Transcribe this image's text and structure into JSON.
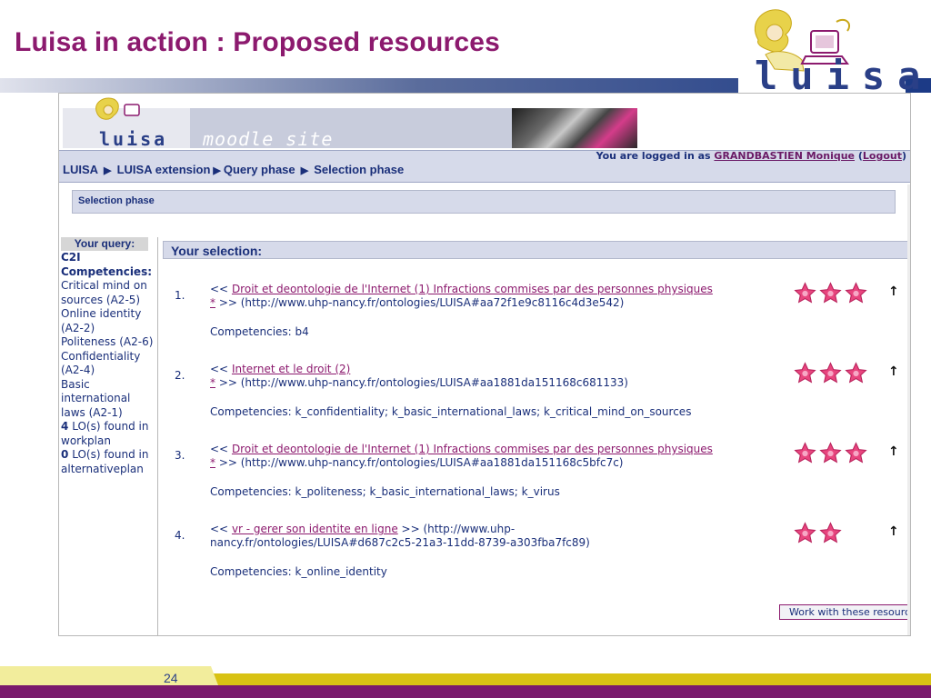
{
  "slide": {
    "title": "Luisa in action : Proposed resources",
    "logo_text": "luisa",
    "page_number": "24"
  },
  "moodle": {
    "banner_logo": "luisa",
    "banner_site": "moodle site",
    "breadcrumb": [
      "LUISA",
      "LUISA extension",
      "Query phase",
      "Selection phase"
    ],
    "login": {
      "prefix": "You are logged in as ",
      "user": "GRANDBASTIEN Monique",
      "logout": "Logout"
    },
    "phase_title": "Selection phase"
  },
  "query": {
    "header": "Your query:",
    "lines": [
      {
        "text": "C2I",
        "bold": true
      },
      {
        "text": "Competencies:",
        "bold": true
      },
      {
        "text": "Critical mind on sources (A2-5)",
        "bold": false
      },
      {
        "text": "Online identity (A2-2)",
        "bold": false
      },
      {
        "text": "Politeness (A2-6)",
        "bold": false
      },
      {
        "text": "Confidentiality (A2-4)",
        "bold": false
      },
      {
        "text": "Basic international laws (A2-1)",
        "bold": false
      }
    ],
    "workplan_count": "4",
    "workplan_text": "LO(s) found in workplan",
    "alt_count": "0",
    "alt_text": "LO(s) found in alternativeplan"
  },
  "selection": {
    "header": "Your selection:",
    "results": [
      {
        "num": "1.",
        "open": "<< ",
        "title": "Droit et deontologie de l'Internet (1) Infractions commises par des personnes physiques",
        "star_link": "*",
        "uri": " >> (http://www.uhp-nancy.fr/ontologies/LUISA#aa72f1e9c8116c4d3e542)",
        "competencies": "Competencies: b4",
        "rating": 3
      },
      {
        "num": "2.",
        "open": "<< ",
        "title": "Internet et le droit (2)",
        "star_link": "*",
        "uri": " >> (http://www.uhp-nancy.fr/ontologies/LUISA#aa1881da151168c681133)",
        "competencies": "Competencies: k_confidentiality; k_basic_international_laws; k_critical_mind_on_sources",
        "rating": 3
      },
      {
        "num": "3.",
        "open": "<< ",
        "title": "Droit et deontologie de l'Internet (1) Infractions commises par des personnes physiques",
        "star_link": "*",
        "uri": " >> (http://www.uhp-nancy.fr/ontologies/LUISA#aa1881da151168c5bfc7c)",
        "competencies": "Competencies: k_politeness; k_basic_international_laws; k_virus",
        "rating": 3
      },
      {
        "num": "4.",
        "open": "<< ",
        "title": "vr - gerer son identite en ligne",
        "star_link": "",
        "uri": " >> (http://www.uhp-nancy.fr/ontologies/LUISA#d687c2c5-21a3-11dd-8739-a303fba7fc89)",
        "competencies": "Competencies: k_online_identity",
        "rating": 2
      }
    ],
    "work_button": "Work with these resources"
  },
  "colors": {
    "title": "#8c1a6e",
    "navy": "#1a2f7a",
    "star": "#e8457e",
    "footer_yellow": "#d8c213",
    "footer_purple": "#7a1a6c"
  },
  "icons": {
    "star": "star-icon",
    "move_up": "up-arrow-icon"
  }
}
